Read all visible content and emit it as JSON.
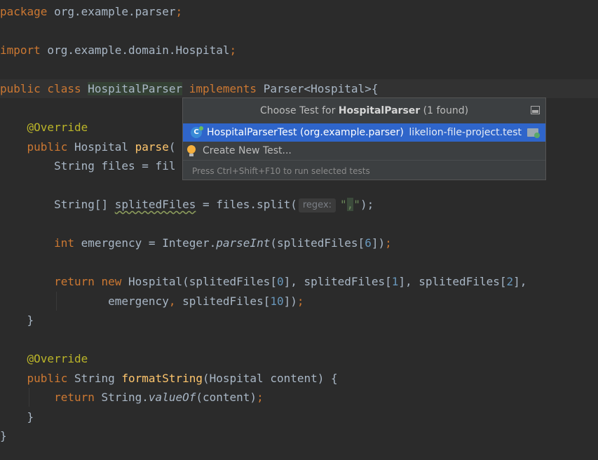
{
  "code": {
    "l1": {
      "kw": "package",
      "text": " org.example.parser",
      "semi": ";"
    },
    "l2": {
      "kw": "import",
      "text": " org.example.domain.Hospital",
      "semi": ";"
    },
    "l3": {
      "kw1": "public class ",
      "cls": "HospitalParser",
      "kw2": " implements",
      "rest": " Parser<Hospital>{"
    },
    "l4": {
      "ann": "@Override"
    },
    "l5": {
      "kw": "public",
      "t1": " Hospital ",
      "fn": "parse",
      "t2": "("
    },
    "l6": {
      "text": "String files = fil"
    },
    "l7": {
      "t1": "String[] ",
      "var": "splitedFiles",
      "t2": " = files.split(",
      "hint": "regex:",
      "q1": "\"",
      "comma": ",",
      "q2": "\"",
      "t3": ");"
    },
    "l8": {
      "kw": "int",
      "t1": " emergency = Integer.",
      "it": "parseInt",
      "t2": "(splitedFiles[",
      "num": "6",
      "t3": "])",
      "semi": ";"
    },
    "l9": {
      "kw1": "return",
      "kw2": " new",
      "t1": " Hospital(splitedFiles[",
      "n1": "0",
      "t2": "], splitedFiles[",
      "n2": "1",
      "t3": "], splitedFiles[",
      "n3": "2",
      "t4": "],",
      "c": ","
    },
    "l10": {
      "t1": "emergency",
      "c": ",",
      "t2": " splitedFiles[",
      "num": "10",
      "t3": "])",
      "semi": ";"
    },
    "l11": {
      "text": "}"
    },
    "l12": {
      "ann": "@Override"
    },
    "l13": {
      "kw": "public",
      "t1": " String ",
      "fn": "formatString",
      "t2": "(Hospital content) {"
    },
    "l14": {
      "kw": "return",
      "t1": " String.",
      "it": "valueOf",
      "t2": "(content)",
      "semi": ";"
    },
    "l15": {
      "text": "}"
    },
    "l16": {
      "text": "}"
    }
  },
  "popup": {
    "title_prefix": "Choose Test for ",
    "title_class": "HospitalParser",
    "title_suffix": " (1 found)",
    "pin_icon": "pin-icon",
    "item1": {
      "icon": "test-class-icon",
      "label": "HospitalParserTest (org.example.parser)",
      "module": "likelion-file-project.test",
      "module_icon": "test-folder-icon"
    },
    "item2": {
      "icon": "lightbulb-icon",
      "label": "Create New Test..."
    },
    "footer": "Press Ctrl+Shift+F10 to run selected tests"
  },
  "colors": {
    "background": "#2b2b2b",
    "keyword": "#cc7832",
    "annotation": "#bbb529",
    "function": "#ffc66d",
    "number": "#6897bb",
    "string": "#6a8759",
    "selection": "#2f65ca"
  }
}
